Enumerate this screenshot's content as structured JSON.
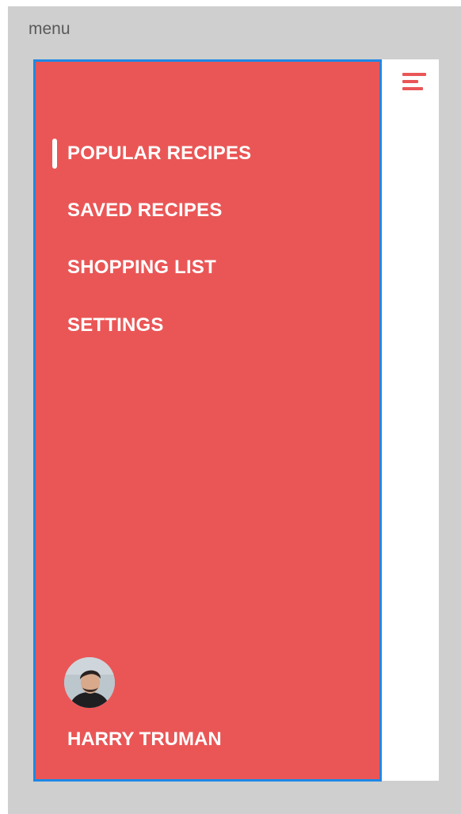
{
  "frame": {
    "label": "menu"
  },
  "drawer": {
    "menu_icon": "hamburger-menu-icon",
    "items": [
      {
        "label": "POPULAR RECIPES",
        "active": true
      },
      {
        "label": "SAVED RECIPES",
        "active": false
      },
      {
        "label": "SHOPPING LIST",
        "active": false
      },
      {
        "label": "SETTINGS",
        "active": false
      }
    ]
  },
  "user": {
    "name": "HARRY TRUMAN",
    "avatar_icon": "user-avatar"
  },
  "colors": {
    "drawer_background": "#ea5656",
    "selection_border": "#1e88e5",
    "text": "#ffffff",
    "canvas": "#cfcfcf"
  }
}
